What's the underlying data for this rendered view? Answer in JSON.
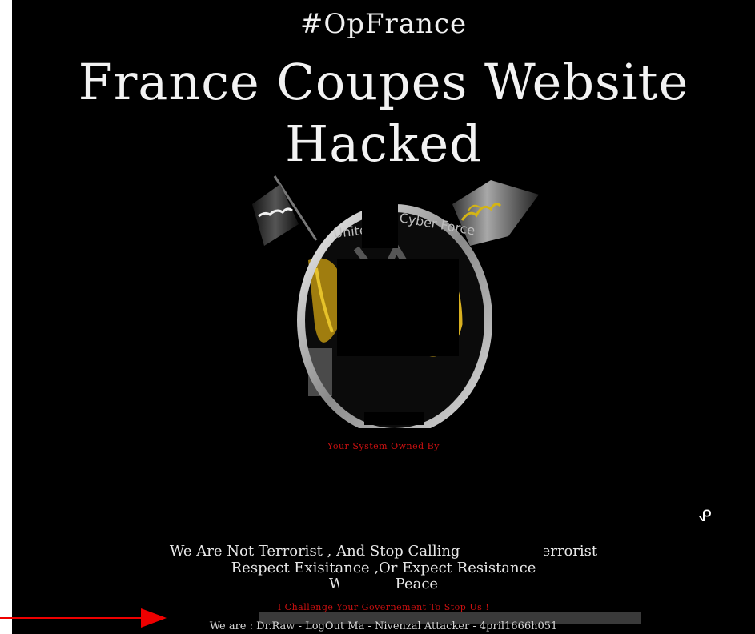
{
  "header": {
    "hashtag": "#OpFrance",
    "headline_line1": "France Coupes Website",
    "headline_line2": "Hacked"
  },
  "emblem": {
    "label_left": "United",
    "label_right": "Cyber Force"
  },
  "owned_text": "Your System Owned By",
  "side_glyph": "ᕵ",
  "messages": {
    "line1": "We Are Not Terrorist , And Stop Calling                Terrorist",
    "line2": "Respect Exisitance ,Or Expect Resistance",
    "line3": "We Love Peace"
  },
  "challenge": "I Challenge Your Governement To Stop Us !",
  "team": "We are : Dr.Raw - LogOut Ma - Nivenzal Attacker - 4pril1666h051",
  "colors": {
    "background": "#000000",
    "text": "#f2f2f2",
    "accent_red": "#cc1111",
    "arrow_red": "#ee0000"
  }
}
